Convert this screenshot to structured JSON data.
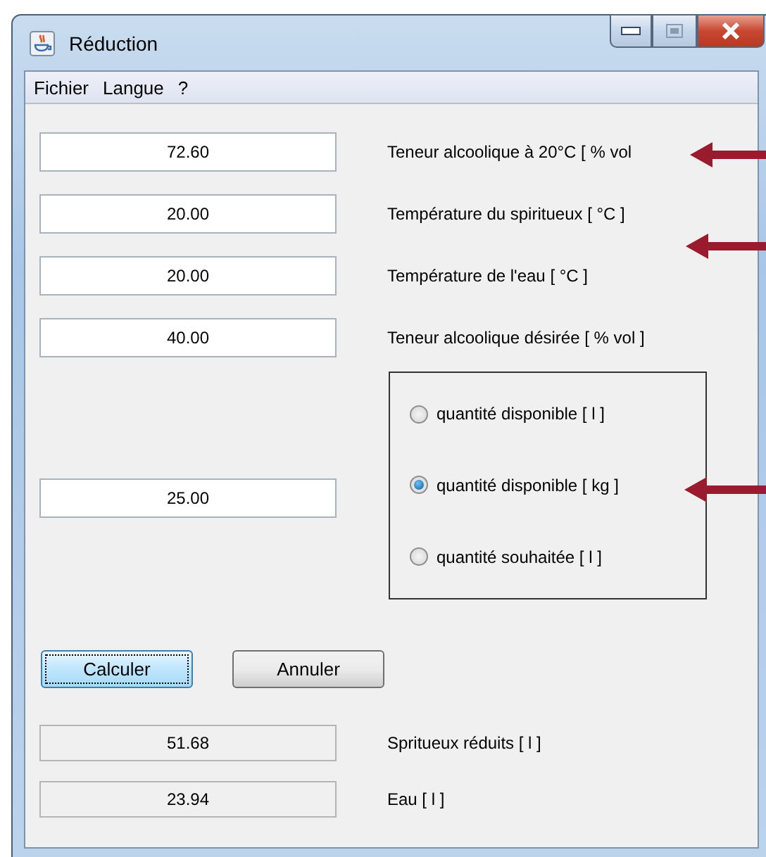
{
  "window": {
    "title": "Réduction"
  },
  "menu": [
    "Fichier",
    "Langue",
    "?"
  ],
  "inputs": [
    {
      "value": "72.60",
      "label": "Teneur alcoolique à 20°C [ % vol"
    },
    {
      "value": "20.00",
      "label": "Température du spiritueux [ °C ]"
    },
    {
      "value": "20.00",
      "label": "Température de l'eau [ °C ]"
    },
    {
      "value": "40.00",
      "label": "Teneur alcoolique désirée [ % vol ]"
    }
  ],
  "quantity": {
    "value": "25.00",
    "options": [
      {
        "label": "quantité disponible [ l ]",
        "selected": false
      },
      {
        "label": "quantité disponible [ kg ]",
        "selected": true
      },
      {
        "label": "quantité souhaitée [ l ]",
        "selected": false
      }
    ]
  },
  "buttons": [
    {
      "label": "Calculer",
      "focused": true
    },
    {
      "label": "Annuler",
      "focused": false
    }
  ],
  "results": [
    {
      "value": "51.68",
      "label": "Spritueux réduits [ l ]"
    },
    {
      "value": "23.94",
      "label": "Eau [ l ]"
    }
  ]
}
